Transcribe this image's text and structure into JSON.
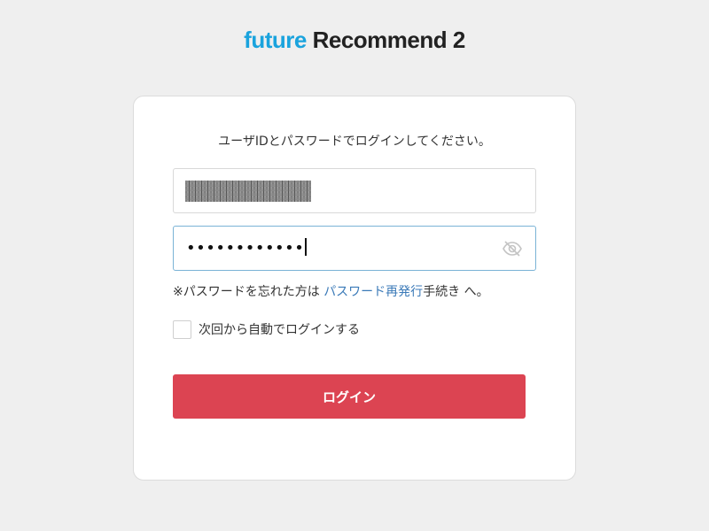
{
  "logo": {
    "part1": "future",
    "part2": "Recommend 2"
  },
  "login": {
    "instruction": "ユーザIDとパスワードでログインしてください。",
    "password_value": "••••••••••••",
    "note": {
      "prefix": "※パスワードを忘れた方は ",
      "link_text": "パスワード再発行",
      "suffix": "手続き へ。"
    },
    "remember_label": "次回から自動でログインする",
    "remember_checked": false,
    "button_label": "ログイン",
    "button_color": "#dc4452",
    "link_color": "#3b7ab8"
  },
  "icons": {
    "password_toggle": "eye-slash-icon"
  }
}
